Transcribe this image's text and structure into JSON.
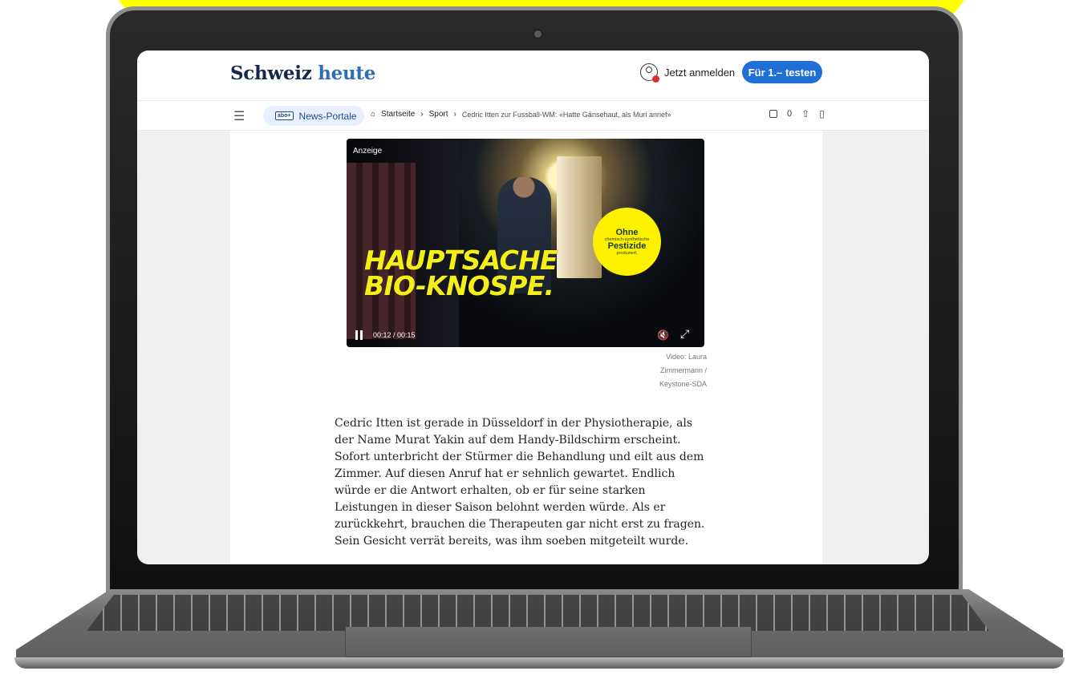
{
  "header": {
    "logo_part_1": "Schweiz",
    "logo_part_2": "heute",
    "login_label": "Jetzt anmelden",
    "cta_label": "Für 1.– testen"
  },
  "nav": {
    "menu_icon": "menu-search-icon",
    "portal_badge": "abo+",
    "portal_label": "News-Portale",
    "breadcrumbs": [
      "Startseite",
      "Sport",
      "Cedric Itten zur Fussball-WM: «Hatte Gänsehaut, als Muri anrief»"
    ],
    "comment_count": "0",
    "share_icon": "share-icon",
    "bookmark_icon": "bookmark-icon"
  },
  "video": {
    "ad_label": "Anzeige",
    "headline_line_1": "HAUPTSACHE",
    "headline_line_2": "BIO-KNOSPE.",
    "seal_line_1": "Ohne",
    "seal_line_2": "chemisch-synthetische",
    "seal_line_3": "Pestizide",
    "seal_line_4": "produziert.",
    "time": "00:12 / 00:15",
    "progress": 0.8,
    "caption": "Video: Laura Zimmermann / Keystone-SDA"
  },
  "article": {
    "paragraph": "Cedric Itten ist gerade in Düsseldorf in der Physiotherapie, als der Name Murat Yakin auf dem Handy-Bildschirm erscheint. Sofort unterbricht der Stürmer die Behandlung und eilt aus dem Zimmer. Auf diesen Anruf hat er sehnlich gewartet. Endlich würde er die Antwort erhalten, ob er für seine starken Leistungen in dieser Saison belohnt werden würde. Als er zurückkehrt, brauchen die Therapeuten gar nicht erst zu fragen. Sein Gesicht verrät bereits, was ihm soeben mitgeteilt wurde."
  },
  "colors": {
    "yellow_background": "#ffff00",
    "brand_blue": "#1f6fd6",
    "logo_navy": "#13284a"
  }
}
